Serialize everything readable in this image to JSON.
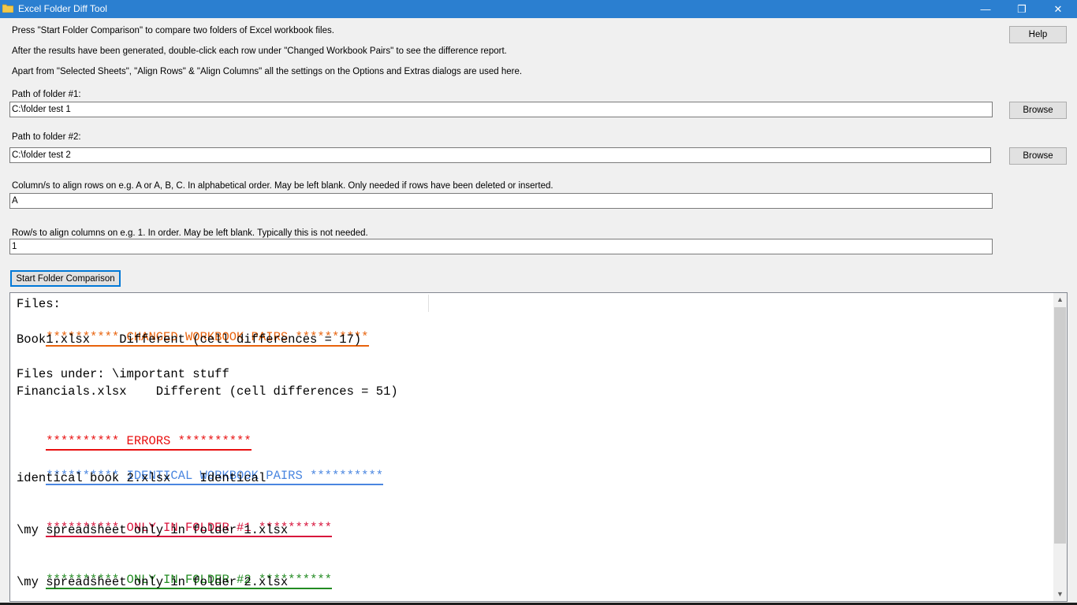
{
  "window": {
    "title": "Excel Folder Diff Tool",
    "minimize_glyph": "—",
    "restore_glyph": "❐",
    "close_glyph": "✕"
  },
  "instructions": {
    "line1": "Press \"Start Folder Comparison\" to compare two folders of Excel workbook files.",
    "line2": "After the results have been generated, double-click each row under \"Changed Workbook Pairs\" to see the difference report.",
    "line3": "Apart from \"Selected Sheets\", \"Align Rows\" & \"Align Columns\" all the settings on the Options and Extras dialogs are used here."
  },
  "help_button": "Help",
  "folder1": {
    "label": "Path of folder #1:",
    "value": "C:\\folder test 1",
    "browse": "Browse"
  },
  "folder2": {
    "label": "Path to folder #2:",
    "value": "C:\\folder test 2",
    "browse": "Browse"
  },
  "align_rows": {
    "label": "Column/s to align rows on e.g. A or A, B, C. In alphabetical order. May be left blank. Only needed if rows have been deleted or inserted.",
    "value": "A"
  },
  "align_cols": {
    "label": "Row/s to align columns on e.g. 1. In order. May be left blank. Typically this is not needed.",
    "value": "1"
  },
  "start_button": "Start Folder Comparison",
  "output": {
    "files_label": "Files:",
    "changed_header": "********** CHANGED WORKBOOK PAIRS **********",
    "changed_rows": [
      "Book1.xlsx    Different (cell differences = 17)",
      "Files under: \\important stuff",
      "Financials.xlsx    Different (cell differences = 51)"
    ],
    "errors_header": "********** ERRORS **********",
    "identical_header": "********** IDENTICAL WORKBOOK PAIRS **********",
    "identical_rows": [
      "identical book 2.xlsx    Identical"
    ],
    "only1_header": "********** ONLY IN FOLDER #1 **********",
    "only1_rows": [
      "\\my spreadsheet only in folder 1.xlsx"
    ],
    "only2_header": "********** ONLY IN FOLDER #2 **********",
    "only2_rows": [
      "\\my spreadsheet only in folder 2.xlsx"
    ]
  },
  "colors": {
    "titlebar": "#2b7fd0",
    "changed": "#e8620c",
    "errors": "#e81010",
    "identical": "#4a86e0",
    "only1": "#d8143c",
    "only2": "#228b22"
  }
}
